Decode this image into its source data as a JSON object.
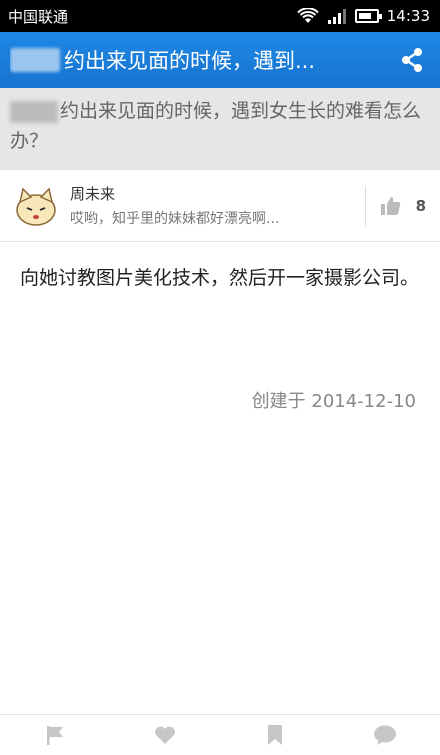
{
  "status_bar": {
    "carrier": "中国联通",
    "time": "14:33"
  },
  "app_bar": {
    "title": "约出来见面的时候，遇到..."
  },
  "question": {
    "title": "约出来见面的时候，遇到女生长的难看怎么办？"
  },
  "author": {
    "name": "周未来",
    "bio": "哎哟，知乎里的妹妹都好漂亮啊...",
    "votes": "8"
  },
  "answer": {
    "body": "向她讨教图片美化技术，然后开一家摄影公司。",
    "created": "创建于 2014-12-10"
  },
  "colors": {
    "accent": "#1e88e5",
    "question_bg": "#e6e6e6"
  },
  "icons": [
    "wifi-icon",
    "signal-icon",
    "battery-icon",
    "share-icon",
    "thumbs-up-icon",
    "flag-icon",
    "heart-icon",
    "bookmark-icon",
    "comment-icon"
  ]
}
